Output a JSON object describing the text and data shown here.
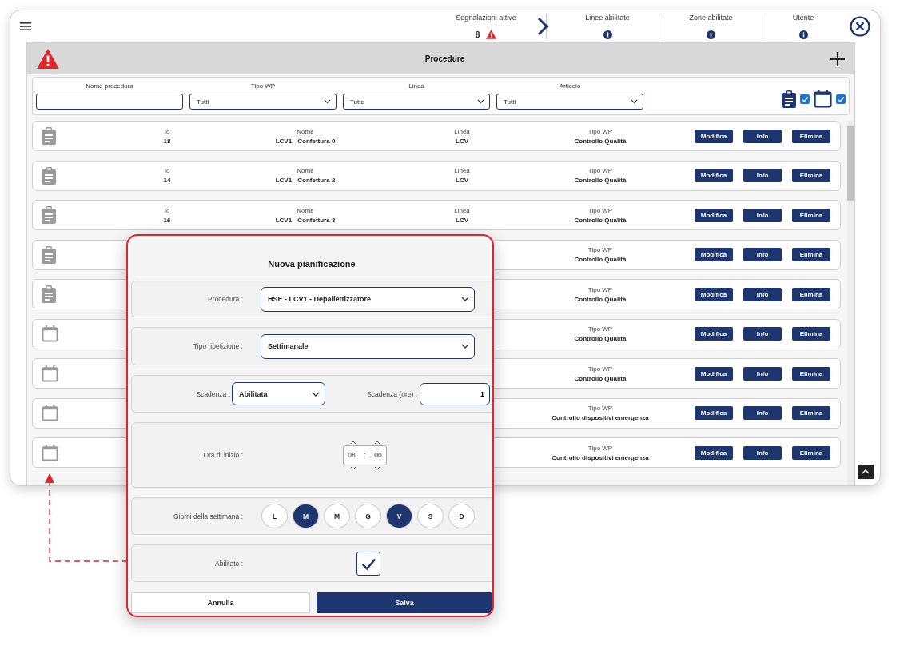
{
  "top_bar": {
    "stats": [
      {
        "label": "Segnalazioni attive",
        "value": "8",
        "kind": "alert"
      },
      {
        "label": "Linee abilitate",
        "kind": "info"
      },
      {
        "label": "Zone abilitate",
        "kind": "info"
      },
      {
        "label": "Utente",
        "kind": "info"
      }
    ]
  },
  "panel": {
    "title": "Procedure"
  },
  "filters": [
    {
      "label": "Nome procedura",
      "kind": "text"
    },
    {
      "label": "Tipo WP",
      "kind": "select",
      "value": "Tutti"
    },
    {
      "label": "Linea",
      "kind": "select",
      "value": "Tutte"
    },
    {
      "label": "Articolo",
      "kind": "select",
      "value": "Tutti"
    }
  ],
  "type_toggles": [
    {
      "kind": "procedure",
      "checked": true
    },
    {
      "kind": "schedule",
      "checked": true
    }
  ],
  "rows": [
    {
      "kind": "procedure",
      "fields": [
        {
          "kind": "id",
          "label": "Id",
          "value": "18"
        },
        {
          "kind": "nome",
          "label": "Nome",
          "value": "LCV1 - Confettura 0"
        },
        {
          "kind": "linea",
          "label": "Linea",
          "value": "LCV"
        },
        {
          "kind": "tipo_wp",
          "label": "Tipo WP",
          "value": "Controllo Qualità"
        }
      ],
      "actions": [
        "Modifica",
        "Info",
        "Elimina"
      ]
    },
    {
      "kind": "procedure",
      "fields": [
        {
          "kind": "id",
          "label": "Id",
          "value": "14"
        },
        {
          "kind": "nome",
          "label": "Nome",
          "value": "LCV1 - Confettura 2"
        },
        {
          "kind": "linea",
          "label": "Linea",
          "value": "LCV"
        },
        {
          "kind": "tipo_wp",
          "label": "Tipo WP",
          "value": "Controllo Qualità"
        }
      ],
      "actions": [
        "Modifica",
        "Info",
        "Elimina"
      ]
    },
    {
      "kind": "procedure",
      "fields": [
        {
          "kind": "id",
          "label": "Id",
          "value": "16"
        },
        {
          "kind": "nome",
          "label": "Nome",
          "value": "LCV1 - Confettura 3"
        },
        {
          "kind": "linea",
          "label": "Linea",
          "value": "LCV"
        },
        {
          "kind": "tipo_wp",
          "label": "Tipo WP",
          "value": "Controllo Qualità"
        }
      ],
      "actions": [
        "Modifica",
        "Info",
        "Elimina"
      ]
    },
    {
      "kind": "procedure",
      "fields": [
        {
          "kind": "tipo_wp",
          "label": "Tipo WP",
          "value": "Controllo Qualità"
        }
      ],
      "actions": [
        "Modifica",
        "Info",
        "Elimina"
      ]
    },
    {
      "kind": "procedure",
      "fields": [
        {
          "kind": "tipo_wp",
          "label": "Tipo WP",
          "value": "Controllo Qualità"
        }
      ],
      "actions": [
        "Modifica",
        "Info",
        "Elimina"
      ]
    },
    {
      "kind": "schedule",
      "fields": [
        {
          "kind": "tipo_wp",
          "label": "Tipo WP",
          "value": "Controllo Qualità"
        }
      ],
      "actions": [
        "Modifica",
        "Info",
        "Elimina"
      ]
    },
    {
      "kind": "schedule",
      "fields": [
        {
          "kind": "tipo_wp",
          "label": "Tipo WP",
          "value": "Controllo Qualità"
        }
      ],
      "actions": [
        "Modifica",
        "Info",
        "Elimina"
      ]
    },
    {
      "kind": "schedule",
      "fields": [
        {
          "kind": "tipo_wp",
          "label": "Tipo WP",
          "value": "Controllo dispositivi emergenza"
        }
      ],
      "actions": [
        "Modifica",
        "Info",
        "Elimina"
      ]
    },
    {
      "kind": "schedule",
      "fields": [
        {
          "kind": "tipo_wp",
          "label": "Tipo WP",
          "value": "Controllo dispositivi emergenza"
        }
      ],
      "actions": [
        "Modifica",
        "Info",
        "Elimina"
      ]
    }
  ],
  "dialog": {
    "title": "Nuova pianificazione",
    "procedura": {
      "label": "Procedura :",
      "value": "HSE - LCV1 - Depallettizzatore"
    },
    "tipo_ripetizione": {
      "label": "Tipo ripetizione :",
      "value": "Settimanale"
    },
    "scadenza": {
      "label": "Scadenza :",
      "value": "Abilitata"
    },
    "scadenza_ore": {
      "label": "Scadenza (ore) :",
      "value": "1"
    },
    "ora_inizio": {
      "label": "Ora di inizio :",
      "hours": "08",
      "separator": ":",
      "minutes": "00"
    },
    "giorni": {
      "label": "Giorni della settimana :",
      "days": [
        {
          "label": "L",
          "selected": false
        },
        {
          "label": "M",
          "selected": true
        },
        {
          "label": "M",
          "selected": false
        },
        {
          "label": "G",
          "selected": false
        },
        {
          "label": "V",
          "selected": true
        },
        {
          "label": "S",
          "selected": false
        },
        {
          "label": "D",
          "selected": false
        }
      ]
    },
    "abilitato": {
      "label": "Abilitato :",
      "checked": true
    },
    "cancel": "Annulla",
    "save": "Salva"
  }
}
